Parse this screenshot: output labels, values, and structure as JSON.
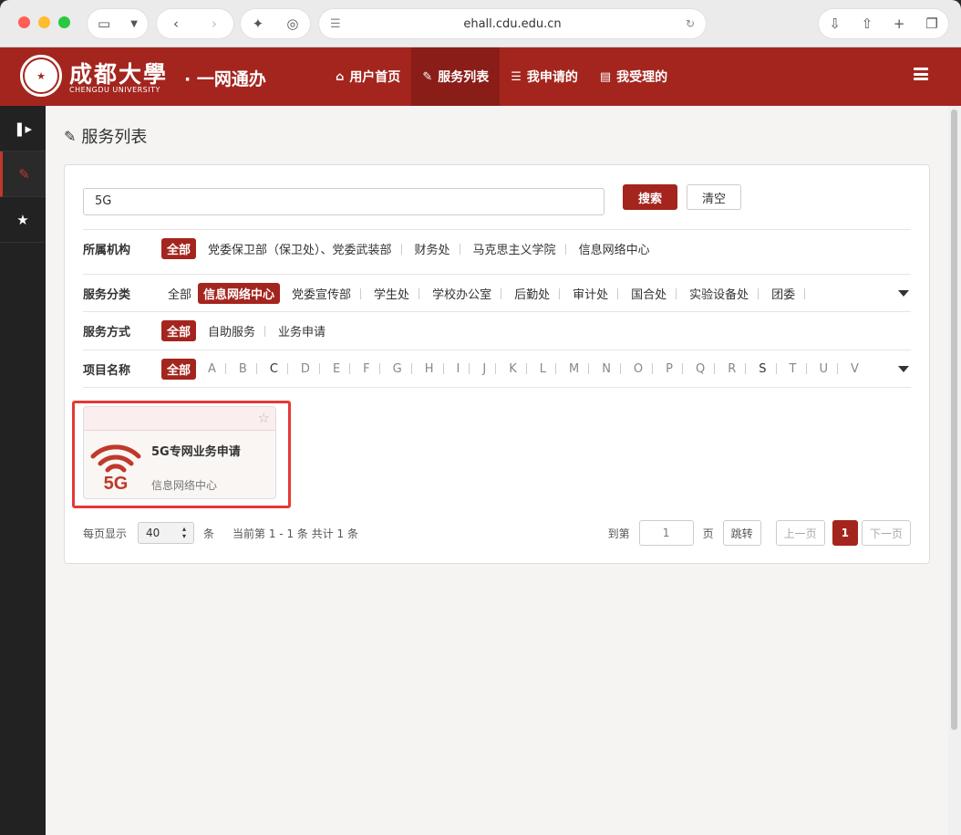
{
  "browser": {
    "url": "ehall.cdu.edu.cn"
  },
  "header": {
    "logo_cn": "成都大學",
    "logo_en": "CHENGDU UNIVERSITY",
    "app_title": "· 一网通办",
    "nav": [
      {
        "label": "用户首页",
        "icon": "home-icon"
      },
      {
        "label": "服务列表",
        "icon": "edit-icon"
      },
      {
        "label": "我申请的",
        "icon": "list-icon"
      },
      {
        "label": "我受理的",
        "icon": "server-icon"
      }
    ]
  },
  "page": {
    "title": "服务列表"
  },
  "search": {
    "value": "5G",
    "search_label": "搜索",
    "clear_label": "清空"
  },
  "filters": {
    "org": {
      "label": "所属机构",
      "options": [
        "全部",
        "党委保卫部（保卫处）、党委武装部",
        "财务处",
        "马克思主义学院",
        "信息网络中心"
      ]
    },
    "category": {
      "label": "服务分类",
      "options": [
        "全部",
        "信息网络中心",
        "党委宣传部",
        "学生处",
        "学校办公室",
        "后勤处",
        "审计处",
        "国合处",
        "实验设备处",
        "团委"
      ]
    },
    "method": {
      "label": "服务方式",
      "options": [
        "全部",
        "自助服务",
        "业务申请"
      ]
    },
    "name": {
      "label": "项目名称",
      "all": "全部",
      "letters": [
        "A",
        "B",
        "C",
        "D",
        "E",
        "F",
        "G",
        "H",
        "I",
        "J",
        "K",
        "L",
        "M",
        "N",
        "O",
        "P",
        "Q",
        "R",
        "S",
        "T",
        "U",
        "V"
      ],
      "active_letters": [
        "C",
        "S"
      ]
    }
  },
  "card": {
    "title": "5G专网业务申请",
    "dept": "信息网络中心",
    "icon_text": "5G"
  },
  "pager": {
    "per_page_label": "每页显示",
    "per_page_value": "40",
    "unit": "条",
    "info": "当前第 1 - 1 条 共计 1 条",
    "goto_label": "到第",
    "goto_value": "1",
    "page_unit": "页",
    "jump_label": "跳转",
    "prev_label": "上一页",
    "current_page": "1",
    "next_label": "下一页"
  },
  "colors": {
    "brand": "#a4251e",
    "highlight": "#e53935"
  }
}
